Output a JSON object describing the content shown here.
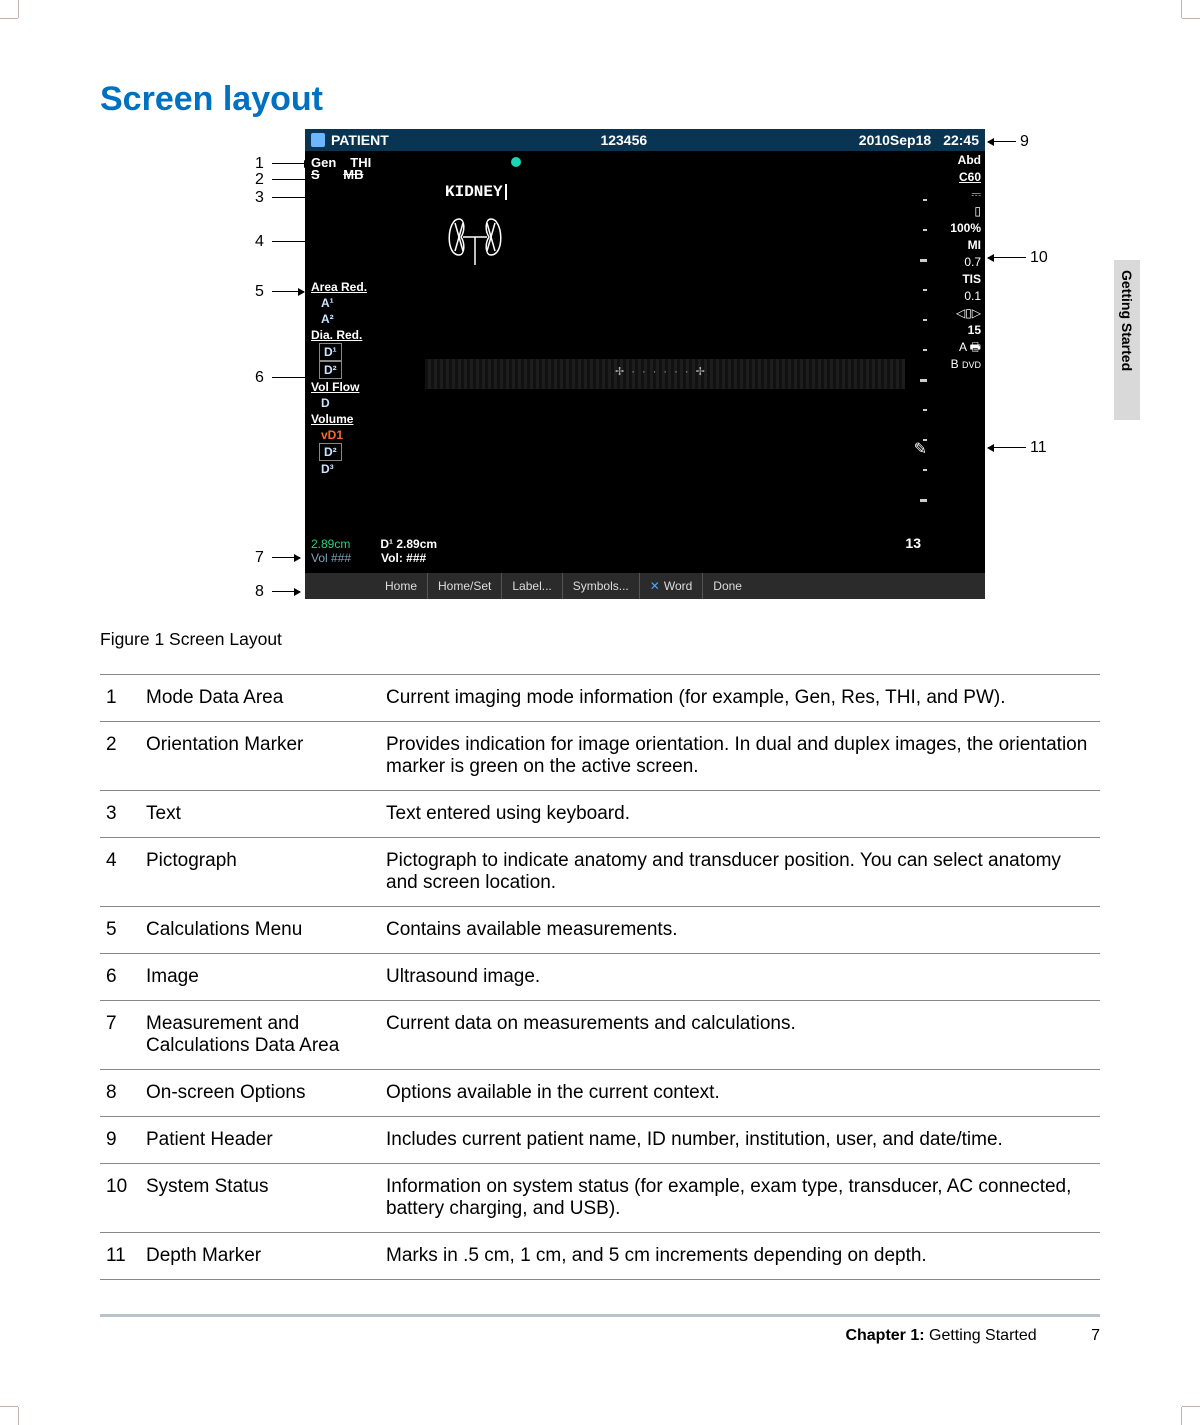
{
  "title": "Screen layout",
  "side_tab": "Getting Started",
  "figure_caption": "Figure 1  Screen Layout",
  "header": {
    "patient_label": "PATIENT",
    "id": "123456",
    "date": "2010Sep18",
    "time": "22:45"
  },
  "topband": {
    "gen": "Gen",
    "thi": "THI",
    "s": "S",
    "mb": "MB"
  },
  "kidney": "KIDNEY",
  "calc": {
    "area": "Area Red.",
    "a1": "A¹",
    "a2": "A²",
    "dia": "Dia. Red.",
    "d1": "D¹",
    "d2": "D²",
    "volflow": "Vol Flow",
    "d": "D",
    "volume": "Volume",
    "vd1": "vD1",
    "vd2": "D²",
    "vd3": "D³"
  },
  "rightcol": {
    "abd": "Abd",
    "c60": "C60",
    "pct": "100%",
    "mi": "MI",
    "miv": "0.7",
    "tis": "TIS",
    "tisv": "0.1",
    "clip15": "15",
    "a": "A",
    "b": "B"
  },
  "depth13": "13",
  "meas": {
    "l1a": "2.89cm",
    "l1b": "D¹  2.89cm",
    "l2a": "Vol ###",
    "l2b": "Vol:  ###"
  },
  "footbar": {
    "home": "Home",
    "homeset": "Home/Set",
    "label": "Label...",
    "symbols": "Symbols...",
    "word": "Word",
    "done": "Done"
  },
  "callouts": {
    "c1": "1",
    "c2": "2",
    "c3": "3",
    "c4": "4",
    "c5": "5",
    "c6": "6",
    "c7": "7",
    "c8": "8",
    "c9": "9",
    "c10": "10",
    "c11": "11"
  },
  "table": [
    {
      "n": "1",
      "name": "Mode Data Area",
      "desc": "Current imaging mode information (for example, Gen, Res, THI, and PW)."
    },
    {
      "n": "2",
      "name": "Orientation Marker",
      "desc": "Provides indication for image orientation. In dual and duplex images, the orientation marker is green on the active screen."
    },
    {
      "n": "3",
      "name": "Text",
      "desc": "Text entered using keyboard."
    },
    {
      "n": "4",
      "name": "Pictograph",
      "desc": "Pictograph to indicate anatomy and transducer position. You can select anatomy and screen location."
    },
    {
      "n": "5",
      "name": "Calculations Menu",
      "desc": "Contains available measurements."
    },
    {
      "n": "6",
      "name": "Image",
      "desc": "Ultrasound image."
    },
    {
      "n": "7",
      "name": "Measurement and Calculations Data Area",
      "desc": "Current data on measurements and calculations."
    },
    {
      "n": "8",
      "name": "On-screen Options",
      "desc": "Options available in the current context."
    },
    {
      "n": "9",
      "name": "Patient Header",
      "desc": "Includes current patient name, ID number, institution, user, and date/time."
    },
    {
      "n": "10",
      "name": "System Status",
      "desc": "Information on system status (for example, exam type, transducer, AC connected, battery charging, and USB)."
    },
    {
      "n": "11",
      "name": "Depth Marker",
      "desc": "Marks in .5 cm, 1 cm, and 5 cm increments depending on depth."
    }
  ],
  "footer": {
    "chapter_label": "Chapter 1:",
    "chapter_title": "  Getting Started",
    "page": "7"
  }
}
